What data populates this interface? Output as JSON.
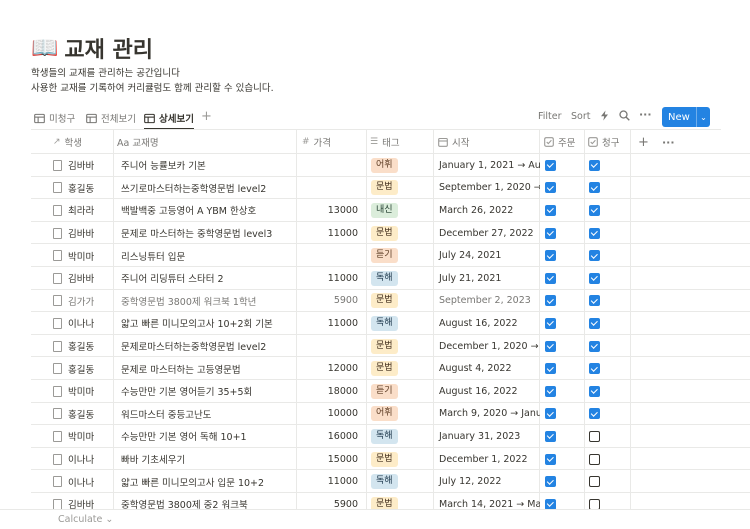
{
  "page": {
    "emoji": "📖",
    "title": "교재 관리",
    "description_line1": "학생들의 교재를 관리하는 공간입니다",
    "description_line2": "사용한 교재를 기록하여 커리큘럼도 함께 관리할 수 있습니다."
  },
  "views": [
    {
      "label": "미청구",
      "active": false,
      "icon": "table-icon"
    },
    {
      "label": "전체보기",
      "active": false,
      "icon": "table-icon"
    },
    {
      "label": "상세보기",
      "active": true,
      "icon": "table-icon"
    }
  ],
  "toolbar": {
    "filter": "Filter",
    "sort": "Sort",
    "new": "New"
  },
  "columns": {
    "student": "학생",
    "name": "Aa 교재명",
    "price": "가격",
    "tag": "태그",
    "start": "시작",
    "order": "주문",
    "bill": "청구"
  },
  "tag_colors": {
    "어휘": {
      "bg": "#fadec9",
      "fg": "#5c3b23"
    },
    "문법": {
      "bg": "#fdecc8",
      "fg": "#402c1b"
    },
    "내신": {
      "bg": "#dbeddb",
      "fg": "#1c3829"
    },
    "듣기": {
      "bg": "#fadec9",
      "fg": "#5c3b23"
    },
    "독해": {
      "bg": "#d3e5ef",
      "fg": "#183347"
    }
  },
  "rows": [
    {
      "student": "김바바",
      "name": "주니어 능률보카 기본",
      "price": "",
      "tag": "어휘",
      "start": "January 1, 2021 → Aug",
      "order": true,
      "bill": true,
      "faded": false
    },
    {
      "student": "홍길동",
      "name": "쓰기로마스터하는중학영문법 level2",
      "price": "",
      "tag": "문법",
      "start": "September 1, 2020 →",
      "order": true,
      "bill": true,
      "faded": false
    },
    {
      "student": "최라라",
      "name": "백발백중 고등영어 A YBM 한상호",
      "price": "13000",
      "tag": "내신",
      "start": "March 26, 2022",
      "order": true,
      "bill": true,
      "faded": false
    },
    {
      "student": "김바바",
      "name": "문제로 마스터하는 중학영문법 level3",
      "price": "11000",
      "tag": "문법",
      "start": "December 27, 2022",
      "order": true,
      "bill": true,
      "faded": false
    },
    {
      "student": "박미마",
      "name": "리스닝튜터 입문",
      "price": "",
      "tag": "듣기",
      "start": "July 24, 2021",
      "order": true,
      "bill": true,
      "faded": false
    },
    {
      "student": "김바바",
      "name": "주니어 리딩튜터 스타터 2",
      "price": "11000",
      "tag": "독해",
      "start": "July 21, 2021",
      "order": true,
      "bill": true,
      "faded": false
    },
    {
      "student": "김가가",
      "name": "중학영문법 3800제 워크북 1학년",
      "price": "5900",
      "tag": "문법",
      "start": "September 2, 2023",
      "order": true,
      "bill": true,
      "faded": true
    },
    {
      "student": "이나나",
      "name": "얇고 빠른 미니모의고사 10+2회 기본",
      "price": "11000",
      "tag": "독해",
      "start": "August 16, 2022",
      "order": true,
      "bill": true,
      "faded": false
    },
    {
      "student": "홍길동",
      "name": "문제로마스터하는중학영문법 level2",
      "price": "",
      "tag": "문법",
      "start": "December 1, 2020 → D",
      "order": true,
      "bill": true,
      "faded": false
    },
    {
      "student": "홍길동",
      "name": "문제로 마스터하는 고등영문법",
      "price": "12000",
      "tag": "문법",
      "start": "August 4, 2022",
      "order": true,
      "bill": true,
      "faded": false
    },
    {
      "student": "박미마",
      "name": "수능만만 기본 영어듣기 35+5회",
      "price": "18000",
      "tag": "듣기",
      "start": "August 16, 2022",
      "order": true,
      "bill": true,
      "faded": false
    },
    {
      "student": "홍길동",
      "name": "워드마스터 중등고난도",
      "price": "10000",
      "tag": "어휘",
      "start": "March 9, 2020 → Janu",
      "order": true,
      "bill": true,
      "faded": false
    },
    {
      "student": "박미마",
      "name": "수능만만 기본 영어 독해 10+1",
      "price": "16000",
      "tag": "독해",
      "start": "January 31, 2023",
      "order": true,
      "bill": false,
      "faded": false
    },
    {
      "student": "이나나",
      "name": "빠바 기초세우기",
      "price": "15000",
      "tag": "문법",
      "start": "December 1, 2022",
      "order": true,
      "bill": false,
      "faded": false
    },
    {
      "student": "이나나",
      "name": "얇고 빠른 미니모의고사 입문 10+2",
      "price": "11000",
      "tag": "독해",
      "start": "July 12, 2022",
      "order": true,
      "bill": false,
      "faded": false
    },
    {
      "student": "김바바",
      "name": "중학영문법 3800제 중2 워크북",
      "price": "5900",
      "tag": "문법",
      "start": "March 14, 2021 → Mar",
      "order": true,
      "bill": false,
      "faded": false
    }
  ],
  "footer": {
    "calculate": "Calculate ⌄"
  }
}
